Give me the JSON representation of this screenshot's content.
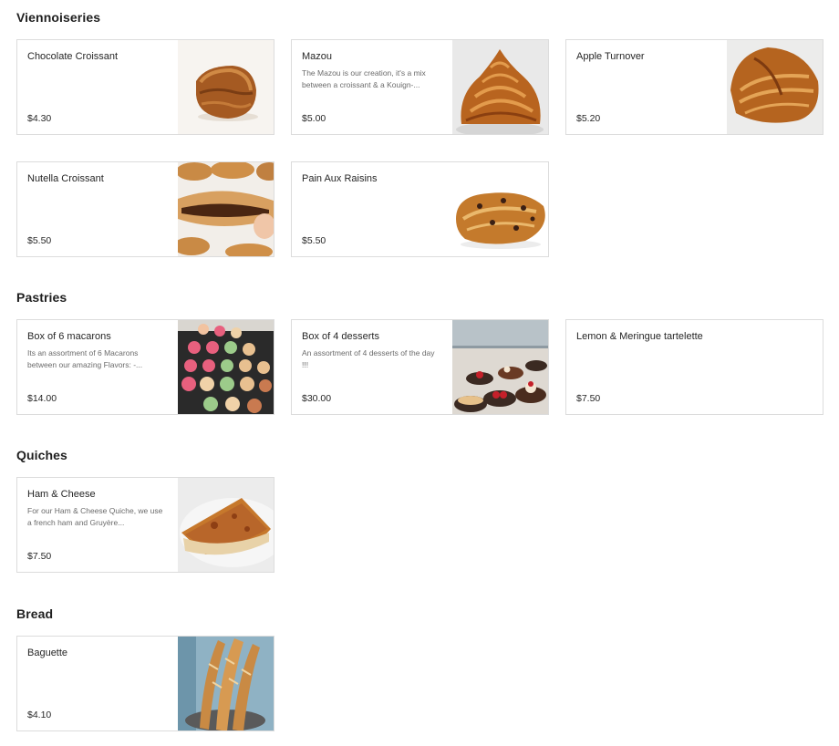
{
  "sections": [
    {
      "title": "Viennoiseries",
      "items": [
        {
          "name": "Chocolate Croissant",
          "description": "",
          "price": "$4.30",
          "image": "chocolate-croissant-photo"
        },
        {
          "name": "Mazou",
          "description": "The Mazou is our creation, it's a mix between a croissant & a Kouign-...",
          "price": "$5.00",
          "image": "mazou-photo"
        },
        {
          "name": "Apple Turnover",
          "description": "",
          "price": "$5.20",
          "image": "apple-turnover-photo"
        },
        {
          "name": "Nutella Croissant",
          "description": "",
          "price": "$5.50",
          "image": "nutella-croissant-photo"
        },
        {
          "name": "Pain Aux Raisins",
          "description": "",
          "price": "$5.50",
          "image": "pain-aux-raisins-photo"
        }
      ]
    },
    {
      "title": "Pastries",
      "items": [
        {
          "name": "Box of 6 macarons",
          "description": "Its an assortment of 6 Macarons between our amazing Flavors: -...",
          "price": "$14.00",
          "image": "macarons-photo"
        },
        {
          "name": "Box of 4 desserts",
          "description": "An assortment of 4 desserts of the day !!!",
          "price": "$30.00",
          "image": "desserts-photo"
        },
        {
          "name": "Lemon & Meringue tartelette",
          "description": "",
          "price": "$7.50",
          "image": ""
        }
      ]
    },
    {
      "title": "Quiches",
      "items": [
        {
          "name": "Ham & Cheese",
          "description": "For our Ham & Cheese Quiche, we use a french ham and Gruyère...",
          "price": "$7.50",
          "image": "quiche-photo"
        }
      ]
    },
    {
      "title": "Bread",
      "items": [
        {
          "name": "Baguette",
          "description": "",
          "price": "$4.10",
          "image": "baguette-photo"
        }
      ]
    }
  ]
}
